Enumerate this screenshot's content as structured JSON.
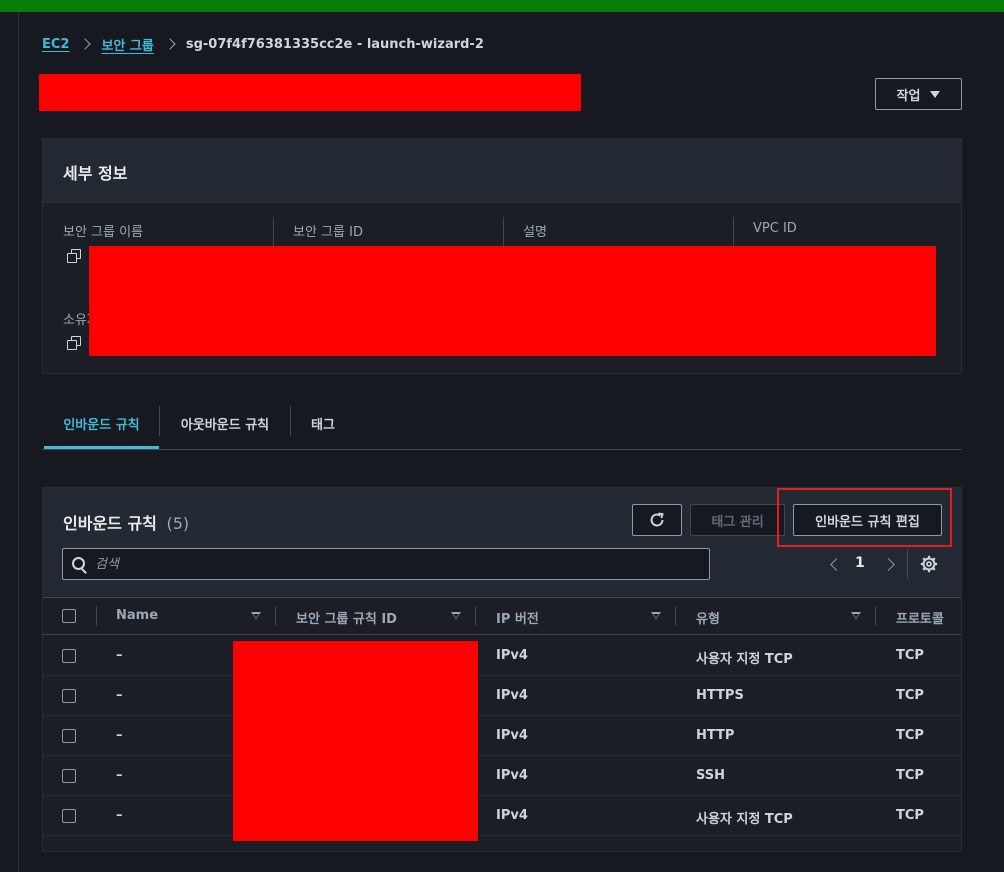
{
  "breadcrumb": {
    "items": [
      "EC2",
      "보안 그룹"
    ],
    "current": "sg-07f4f76381335cc2e - launch-wizard-2"
  },
  "actions_button": {
    "label": "작업"
  },
  "details": {
    "title": "세부 정보",
    "fields": [
      "보안 그룹 이름",
      "보안 그룹 ID",
      "설명",
      "VPC ID"
    ],
    "owner_label": "소유자"
  },
  "tabs": [
    {
      "label": "인바운드 규칙",
      "active": true
    },
    {
      "label": "아웃바운드 규칙",
      "active": false
    },
    {
      "label": "태그",
      "active": false
    }
  ],
  "rules": {
    "title": "인바운드 규칙",
    "count": "(5)",
    "refresh_icon": "refresh-icon",
    "manage_tags_label": "태그 관리",
    "edit_rules_label": "인바운드 규칙 편집",
    "search_placeholder": "검색",
    "page": "1",
    "columns": [
      "Name",
      "보안 그룹 규칙 ID",
      "IP 버전",
      "유형",
      "프로토콜"
    ],
    "rows": [
      {
        "name": "–",
        "ip_version": "IPv4",
        "type": "사용자 지정 TCP",
        "protocol": "TCP"
      },
      {
        "name": "–",
        "ip_version": "IPv4",
        "type": "HTTPS",
        "protocol": "TCP"
      },
      {
        "name": "–",
        "ip_version": "IPv4",
        "type": "HTTP",
        "protocol": "TCP"
      },
      {
        "name": "–",
        "ip_version": "IPv4",
        "type": "SSH",
        "protocol": "TCP"
      },
      {
        "name": "–",
        "ip_version": "IPv4",
        "type": "사용자 지정 TCP",
        "protocol": "TCP"
      }
    ]
  },
  "colors": {
    "accent": "#44b9d6",
    "redaction": "#ff0000",
    "highlight": "#e41e1e",
    "top_bar": "#0a7c0a"
  }
}
